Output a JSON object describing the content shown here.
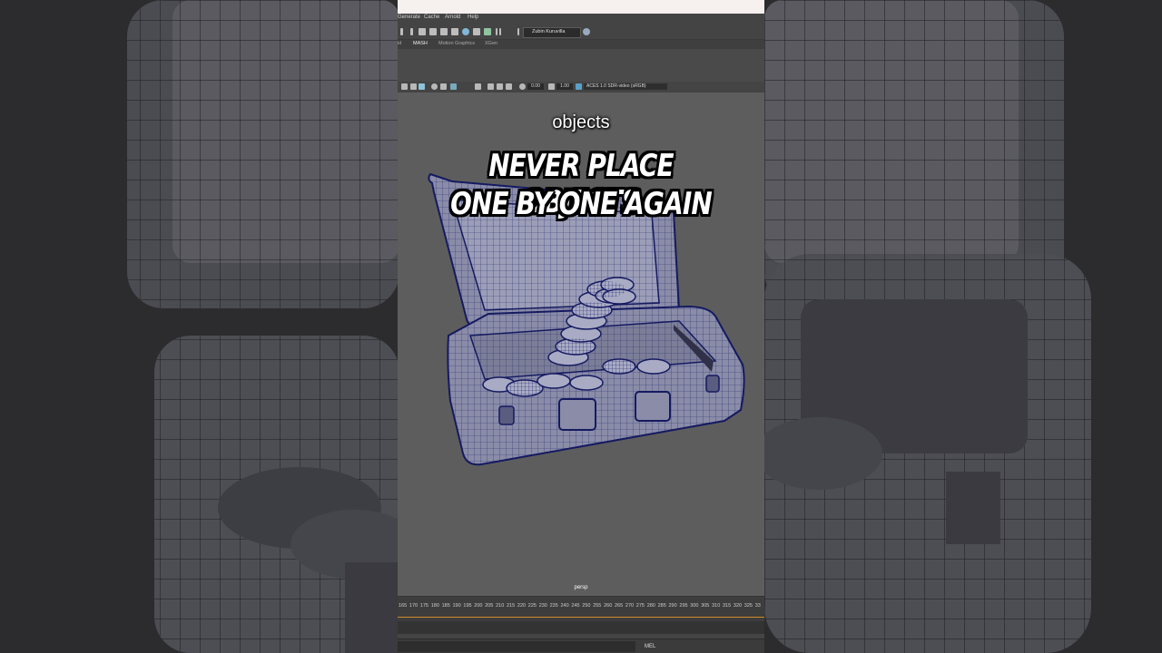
{
  "menus": [
    "Generate",
    "Cache",
    "Arnold",
    "Help"
  ],
  "user": "Zubin Kuruvilla",
  "shelf_tabs": [
    "id",
    "MASH",
    "Motion Graphics",
    "XGen"
  ],
  "active_shelf_tab": "MASH",
  "viewport": {
    "exposure": "0.00",
    "gamma": "1.00",
    "color_space": "ACES 1.0 SDR-video (sRGB)",
    "camera": "persp"
  },
  "captions": {
    "subtitle": "objects",
    "headline_line1": "NEVER PLACE OBJECTS",
    "headline_line2": "ONE BY ONE AGAIN"
  },
  "timeline_ticks": [
    "165",
    "170",
    "175",
    "180",
    "185",
    "190",
    "195",
    "200",
    "205",
    "210",
    "215",
    "220",
    "225",
    "230",
    "235",
    "240",
    "245",
    "250",
    "255",
    "260",
    "265",
    "270",
    "275",
    "280",
    "285",
    "290",
    "295",
    "300",
    "305",
    "310",
    "315",
    "320",
    "325",
    "33"
  ],
  "command_line": {
    "language": "MEL"
  },
  "colors": {
    "timeline_accent": "#d08a2a",
    "wireframe": "#1a1f6a",
    "viewport_bg": "#5d5d5d"
  },
  "icons": [
    "render-icon",
    "pause-icon",
    "user-icon",
    "globe-icon",
    "camera-icon",
    "light-icon",
    "colorspace-icon"
  ]
}
